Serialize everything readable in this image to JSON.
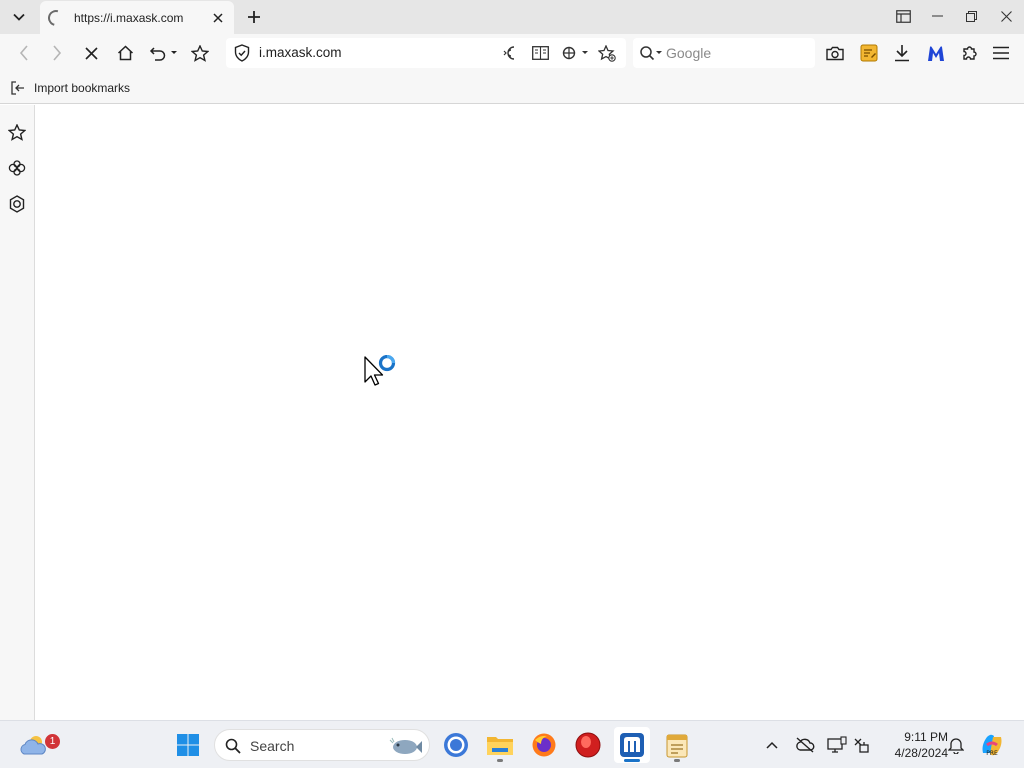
{
  "browser": {
    "tab": {
      "title": "https://i.maxask.com",
      "loading": true
    },
    "url": "i.maxask.com",
    "search": {
      "placeholder": "Google"
    },
    "bookmarks_bar": {
      "items": [
        {
          "label": "Import bookmarks",
          "icon": "import-icon"
        }
      ]
    },
    "sidebar": {
      "items": [
        {
          "icon": "star-outline-icon"
        },
        {
          "icon": "extension-cube-icon"
        },
        {
          "icon": "hexagon-gear-icon"
        }
      ]
    },
    "toolbar_icons": [
      "camera-icon",
      "notes-icon",
      "download-icon",
      "malwarebytes-icon",
      "extensions-puzzle-icon",
      "menu-icon"
    ],
    "accent_color": "#1a73c8"
  },
  "taskbar": {
    "search_label": "Search",
    "weather_badge": "1",
    "clock": {
      "time": "9:11 PM",
      "date": "4/28/2024"
    },
    "apps": [
      "start-icon",
      "search",
      "chrome-icon",
      "file-explorer-icon",
      "firefox-icon",
      "opera-icon",
      "maxthon-icon",
      "notepad-icon"
    ]
  }
}
